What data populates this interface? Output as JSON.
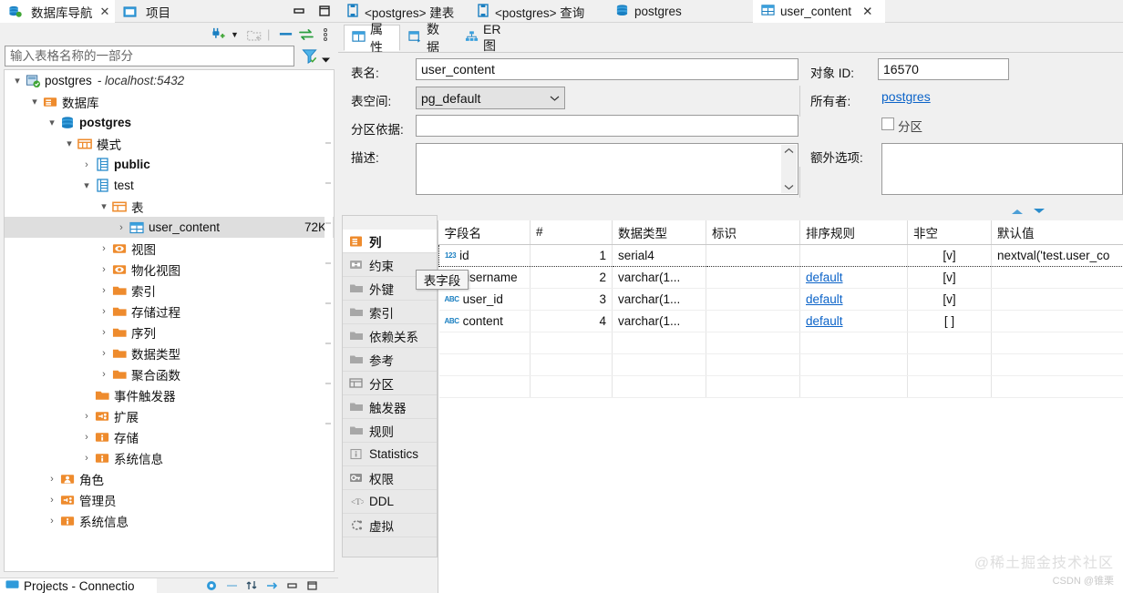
{
  "window": {
    "minimize_icon": "minimize-icon",
    "maximize_icon": "maximize-icon"
  },
  "left_panel": {
    "tabs": [
      {
        "label": "数据库导航",
        "icon": "database-navigator-icon",
        "active": true,
        "closable": true,
        "close_glyph": "✕"
      },
      {
        "label": "项目",
        "icon": "project-folder-icon",
        "active": false,
        "closable": false
      }
    ],
    "toolbar": [
      {
        "name": "new-connection-icon",
        "glyph": "plug-plus"
      },
      {
        "name": "new-connection-dropdown-icon",
        "glyph": "▼"
      },
      {
        "name": "new-folder-icon",
        "glyph": "folder-plus"
      },
      {
        "name": "collapse-all-icon",
        "glyph": "collapse"
      },
      {
        "name": "link-with-editor-icon",
        "glyph": "↔"
      },
      {
        "name": "view-menu-icon",
        "glyph": "⋮"
      }
    ],
    "filter": {
      "placeholder": "输入表格名称的一部分",
      "value": "",
      "funnel_icon": "filter-funnel-icon",
      "caret_icon": "chevron-down-icon"
    },
    "tree": [
      {
        "indent": 0,
        "twisty": "▾",
        "icon": "connection-postgres-icon",
        "label": "postgres",
        "bold": false,
        "sub": "- localhost:5432",
        "size": "",
        "selected": false
      },
      {
        "indent": 1,
        "twisty": "▾",
        "icon": "folder-databases-icon",
        "label": "数据库",
        "bold": false,
        "sub": "",
        "size": "",
        "selected": false
      },
      {
        "indent": 2,
        "twisty": "▾",
        "icon": "database-icon",
        "label": "postgres",
        "bold": true,
        "sub": "",
        "size": "",
        "selected": false
      },
      {
        "indent": 3,
        "twisty": "▾",
        "icon": "schemas-folder-icon",
        "label": "模式",
        "bold": false,
        "sub": "",
        "size": "",
        "selected": false
      },
      {
        "indent": 4,
        "twisty": "›",
        "icon": "schema-icon",
        "label": "public",
        "bold": true,
        "sub": "",
        "size": "",
        "selected": false
      },
      {
        "indent": 4,
        "twisty": "▾",
        "icon": "schema-icon",
        "label": "test",
        "bold": false,
        "sub": "",
        "size": "",
        "selected": false
      },
      {
        "indent": 5,
        "twisty": "▾",
        "icon": "tables-folder-icon",
        "label": "表",
        "bold": false,
        "sub": "",
        "size": "",
        "selected": false
      },
      {
        "indent": 6,
        "twisty": "›",
        "icon": "table-icon",
        "label": "user_content",
        "bold": false,
        "sub": "",
        "size": "72K",
        "selected": true
      },
      {
        "indent": 5,
        "twisty": "›",
        "icon": "views-folder-icon",
        "label": "视图",
        "bold": false,
        "sub": "",
        "size": "",
        "selected": false
      },
      {
        "indent": 5,
        "twisty": "›",
        "icon": "matviews-folder-icon",
        "label": "物化视图",
        "bold": false,
        "sub": "",
        "size": "",
        "selected": false
      },
      {
        "indent": 5,
        "twisty": "›",
        "icon": "folder-icon",
        "label": "索引",
        "bold": false,
        "sub": "",
        "size": "",
        "selected": false
      },
      {
        "indent": 5,
        "twisty": "›",
        "icon": "folder-icon",
        "label": "存储过程",
        "bold": false,
        "sub": "",
        "size": "",
        "selected": false
      },
      {
        "indent": 5,
        "twisty": "›",
        "icon": "folder-icon",
        "label": "序列",
        "bold": false,
        "sub": "",
        "size": "",
        "selected": false
      },
      {
        "indent": 5,
        "twisty": "›",
        "icon": "folder-icon",
        "label": "数据类型",
        "bold": false,
        "sub": "",
        "size": "",
        "selected": false
      },
      {
        "indent": 5,
        "twisty": "›",
        "icon": "folder-icon",
        "label": "聚合函数",
        "bold": false,
        "sub": "",
        "size": "",
        "selected": false
      },
      {
        "indent": 4,
        "twisty": "",
        "icon": "folder-icon",
        "label": "事件触发器",
        "bold": false,
        "sub": "",
        "size": "",
        "selected": false
      },
      {
        "indent": 4,
        "twisty": "›",
        "icon": "extensions-icon",
        "label": "扩展",
        "bold": false,
        "sub": "",
        "size": "",
        "selected": false
      },
      {
        "indent": 4,
        "twisty": "›",
        "icon": "info-folder-icon",
        "label": "存储",
        "bold": false,
        "sub": "",
        "size": "",
        "selected": false
      },
      {
        "indent": 4,
        "twisty": "›",
        "icon": "info-folder-icon",
        "label": "系统信息",
        "bold": false,
        "sub": "",
        "size": "",
        "selected": false
      },
      {
        "indent": 2,
        "twisty": "›",
        "icon": "roles-icon",
        "label": "角色",
        "bold": false,
        "sub": "",
        "size": "",
        "selected": false
      },
      {
        "indent": 2,
        "twisty": "›",
        "icon": "admin-icon",
        "label": "管理员",
        "bold": false,
        "sub": "",
        "size": "",
        "selected": false
      },
      {
        "indent": 2,
        "twisty": "›",
        "icon": "info-folder-icon",
        "label": "系统信息",
        "bold": false,
        "sub": "",
        "size": "",
        "selected": false
      }
    ],
    "bottom_strip": {
      "tab_label": "Projects - Connectio",
      "tab_icon": "projects-icon",
      "tools": [
        "gear-icon",
        "minus-icon",
        "sort-icon",
        "arrow-right-icon",
        "minimize-icon",
        "maximize-icon"
      ]
    }
  },
  "editor": {
    "tabs": [
      {
        "label": "<postgres> 建表",
        "icon": "sql-editor-icon",
        "active": false,
        "closable": false
      },
      {
        "label": "<postgres> 查询",
        "icon": "sql-editor-icon",
        "active": false,
        "closable": false
      },
      {
        "label": "postgres",
        "icon": "database-icon",
        "active": false,
        "closable": false
      },
      {
        "label": "user_content",
        "icon": "table-icon",
        "active": true,
        "closable": true,
        "close_glyph": "✕"
      }
    ],
    "subtabs": [
      {
        "label": "属性",
        "icon": "properties-icon",
        "active": true
      },
      {
        "label": "数据",
        "icon": "data-grid-icon",
        "active": false
      },
      {
        "label": "ER 图",
        "icon": "er-diagram-icon",
        "active": false
      }
    ],
    "properties": {
      "table_name_label": "表名:",
      "table_name_value": "user_content",
      "tablespace_label": "表空间:",
      "tablespace_value": "pg_default",
      "partition_key_label": "分区依据:",
      "partition_key_value": "",
      "description_label": "描述:",
      "description_value": "",
      "object_id_label": "对象 ID:",
      "object_id_value": "16570",
      "owner_label": "所有者:",
      "owner_value": "postgres",
      "partitioned_label": "分区",
      "partitioned_checked": false,
      "extra_options_label": "额外选项:",
      "extra_options_value": ""
    },
    "vertical_tabs": [
      {
        "label": "列",
        "icon": "columns-icon",
        "active": true
      },
      {
        "label": "约束",
        "icon": "constraint-icon",
        "active": false
      },
      {
        "label": "外键",
        "icon": "foreign-key-icon",
        "active": false
      },
      {
        "label": "索引",
        "icon": "index-icon",
        "active": false
      },
      {
        "label": "依赖关系",
        "icon": "dependency-icon",
        "active": false
      },
      {
        "label": "参考",
        "icon": "reference-icon",
        "active": false
      },
      {
        "label": "分区",
        "icon": "partition-icon",
        "active": false
      },
      {
        "label": "触发器",
        "icon": "trigger-icon",
        "active": false
      },
      {
        "label": "规则",
        "icon": "rule-icon",
        "active": false
      },
      {
        "label": "Statistics",
        "icon": "statistics-icon",
        "active": false
      },
      {
        "label": "权限",
        "icon": "permission-key-icon",
        "active": false
      },
      {
        "label": "DDL",
        "icon": "ddl-icon",
        "active": false
      },
      {
        "label": "虚拟",
        "icon": "virtual-icon",
        "active": false
      }
    ],
    "grid_tools": [
      {
        "name": "move-up-icon",
        "glyph": "▲"
      },
      {
        "name": "move-down-icon",
        "glyph": "▼"
      }
    ],
    "columns_grid": {
      "headers": [
        "字段名",
        "#",
        "数据类型",
        "标识",
        "排序规则",
        "非空",
        "默认值"
      ],
      "rows": [
        {
          "selected": true,
          "type_badge": "123",
          "name": "id",
          "ordinal": "1",
          "data_type": "serial4",
          "identity": "",
          "collation": "",
          "collation_link": false,
          "not_null": "[v]",
          "default": "nextval('test.user_co"
        },
        {
          "selected": false,
          "type_badge": "ABC",
          "name": "username",
          "ordinal": "2",
          "data_type": "varchar(1...",
          "identity": "",
          "collation": "default",
          "collation_link": true,
          "not_null": "[v]",
          "default": ""
        },
        {
          "selected": false,
          "type_badge": "ABC",
          "name": "user_id",
          "ordinal": "3",
          "data_type": "varchar(1...",
          "identity": "",
          "collation": "default",
          "collation_link": true,
          "not_null": "[v]",
          "default": ""
        },
        {
          "selected": false,
          "type_badge": "ABC",
          "name": "content",
          "ordinal": "4",
          "data_type": "varchar(1...",
          "identity": "",
          "collation": "default",
          "collation_link": true,
          "not_null": "[ ]",
          "default": ""
        }
      ]
    }
  },
  "tooltip": {
    "text": "表字段"
  },
  "watermark": {
    "line1": "@稀土掘金技术社区",
    "line2": "CSDN @锥栗"
  },
  "colors": {
    "accent_blue": "#1a7fc1",
    "link_blue": "#0b63c8",
    "folder_orange": "#ee8b2d",
    "selection_gray": "#dedede",
    "panel_bg": "#f0f0f0"
  }
}
